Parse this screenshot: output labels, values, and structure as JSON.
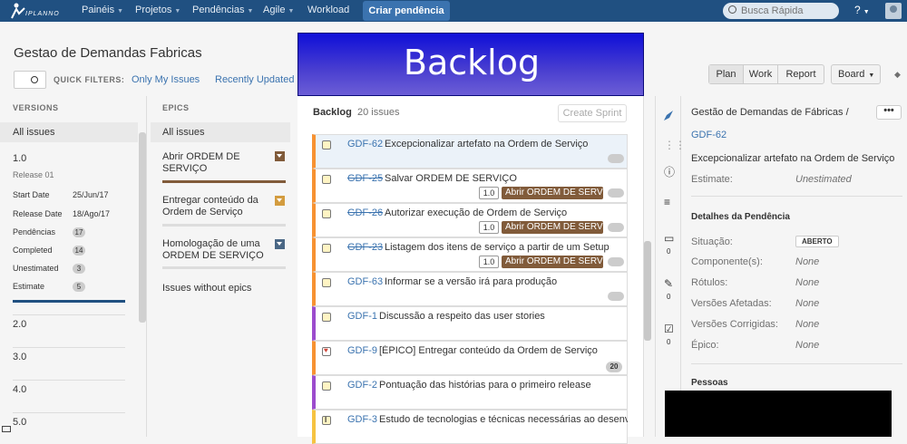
{
  "nav": {
    "logo_text": "IPLANNO",
    "items": [
      "Painéis",
      "Projetos",
      "Pendências",
      "Agile",
      "Workload"
    ],
    "create_label": "Criar pendência",
    "search_placeholder": "Busca Rápida",
    "help": "?"
  },
  "header": {
    "title": "Gestao de Demandas Fabricas",
    "quick_filters_label": "QUICK FILTERS:",
    "filters": [
      "Only My Issues",
      "Recently Updated"
    ],
    "modes": [
      "Plan",
      "Work",
      "Report"
    ],
    "board_label": "Board"
  },
  "versions": {
    "heading": "VERSIONS",
    "all_label": "All issues",
    "v1": {
      "name": "1.0",
      "release": "Release 01",
      "start_label": "Start Date",
      "start": "25/Jun/17",
      "release_label": "Release Date",
      "release_date": "18/Ago/17",
      "stats": [
        {
          "label": "Pendências",
          "value": "17"
        },
        {
          "label": "Completed",
          "value": "14"
        },
        {
          "label": "Unestimated",
          "value": "3"
        },
        {
          "label": "Estimate",
          "value": "5"
        }
      ]
    },
    "others": [
      "2.0",
      "3.0",
      "4.0",
      "5.0"
    ]
  },
  "epics": {
    "heading": "EPICS",
    "all_label": "All issues",
    "items": [
      {
        "name": "Abrir ORDEM DE SERVIÇO",
        "color": "#815b3a"
      },
      {
        "name": "Entregar conteúdo da Ordem de Serviço",
        "color": "#d39c3f"
      },
      {
        "name": "Homologação de uma ORDEM DE SERVIÇO",
        "color": "#4a6785"
      }
    ],
    "without": "Issues without epics"
  },
  "overlay": {
    "title": "Backlog"
  },
  "backlog": {
    "title": "Backlog",
    "count": "20 issues",
    "create_sprint": "Create Sprint",
    "issues": [
      {
        "key": "GDF-62",
        "summary": "Excepcionalizar artefato na Ordem de Serviço",
        "done": false,
        "bar": "#f79232",
        "type": "story",
        "version": "",
        "epic": "",
        "points": ""
      },
      {
        "key": "GDF-25",
        "summary": "Salvar ORDEM DE SERVIÇO",
        "done": true,
        "bar": "#f79232",
        "type": "story",
        "version": "1.0",
        "epic": "Abrir ORDEM DE SERVIÇO",
        "points": ""
      },
      {
        "key": "GDF-26",
        "summary": "Autorizar execução de Ordem de Serviço",
        "done": true,
        "bar": "#f79232",
        "type": "story",
        "version": "1.0",
        "epic": "Abrir ORDEM DE SERVIÇO",
        "points": ""
      },
      {
        "key": "GDF-23",
        "summary": "Listagem dos itens de serviço a partir de um Setup",
        "done": true,
        "bar": "#f79232",
        "type": "story",
        "version": "1.0",
        "epic": "Abrir ORDEM DE SERVIÇO",
        "points": ""
      },
      {
        "key": "GDF-63",
        "summary": "Informar se a versão irá para produção",
        "done": false,
        "bar": "#f79232",
        "type": "story",
        "version": "",
        "epic": "",
        "points": ""
      },
      {
        "key": "GDF-1",
        "summary": "Discussão a respeito das user stories",
        "done": false,
        "bar": "#9c4ccd",
        "type": "story",
        "version": "",
        "epic": "",
        "points": ""
      },
      {
        "key": "GDF-9",
        "summary": "[ÉPICO] Entregar conteúdo da Ordem de Serviço",
        "done": false,
        "bar": "#f79232",
        "type": "epic",
        "version": "",
        "epic": "",
        "points": "20"
      },
      {
        "key": "GDF-2",
        "summary": "Pontuação das histórias para o primeiro release",
        "done": false,
        "bar": "#9c4ccd",
        "type": "story",
        "version": "",
        "epic": "",
        "points": ""
      },
      {
        "key": "GDF-3",
        "summary": "Estudo de tecnologias e técnicas necessárias ao desenvol",
        "done": false,
        "bar": "#f6c342",
        "type": "general",
        "version": "",
        "epic": "",
        "points": ""
      }
    ]
  },
  "detail": {
    "project": "Gestão de Demandas de Fábricas /",
    "key": "GDF-62",
    "more": "•••",
    "title": "Excepcionalizar artefato na Ordem de Serviço",
    "estimate_label": "Estimate:",
    "estimate_value": "Unestimated",
    "section": "Detalhes da Pendência",
    "status_label": "Situação:",
    "status": "ABERTO",
    "fields": [
      {
        "label": "Componente(s):",
        "value": "None"
      },
      {
        "label": "Rótulos:",
        "value": "None"
      },
      {
        "label": "Versões Afetadas:",
        "value": "None"
      },
      {
        "label": "Versões Corrigidas:",
        "value": "None"
      },
      {
        "label": "Épico:",
        "value": "None"
      }
    ],
    "people": "Pessoas",
    "counts": [
      "0",
      "0",
      "0"
    ]
  }
}
